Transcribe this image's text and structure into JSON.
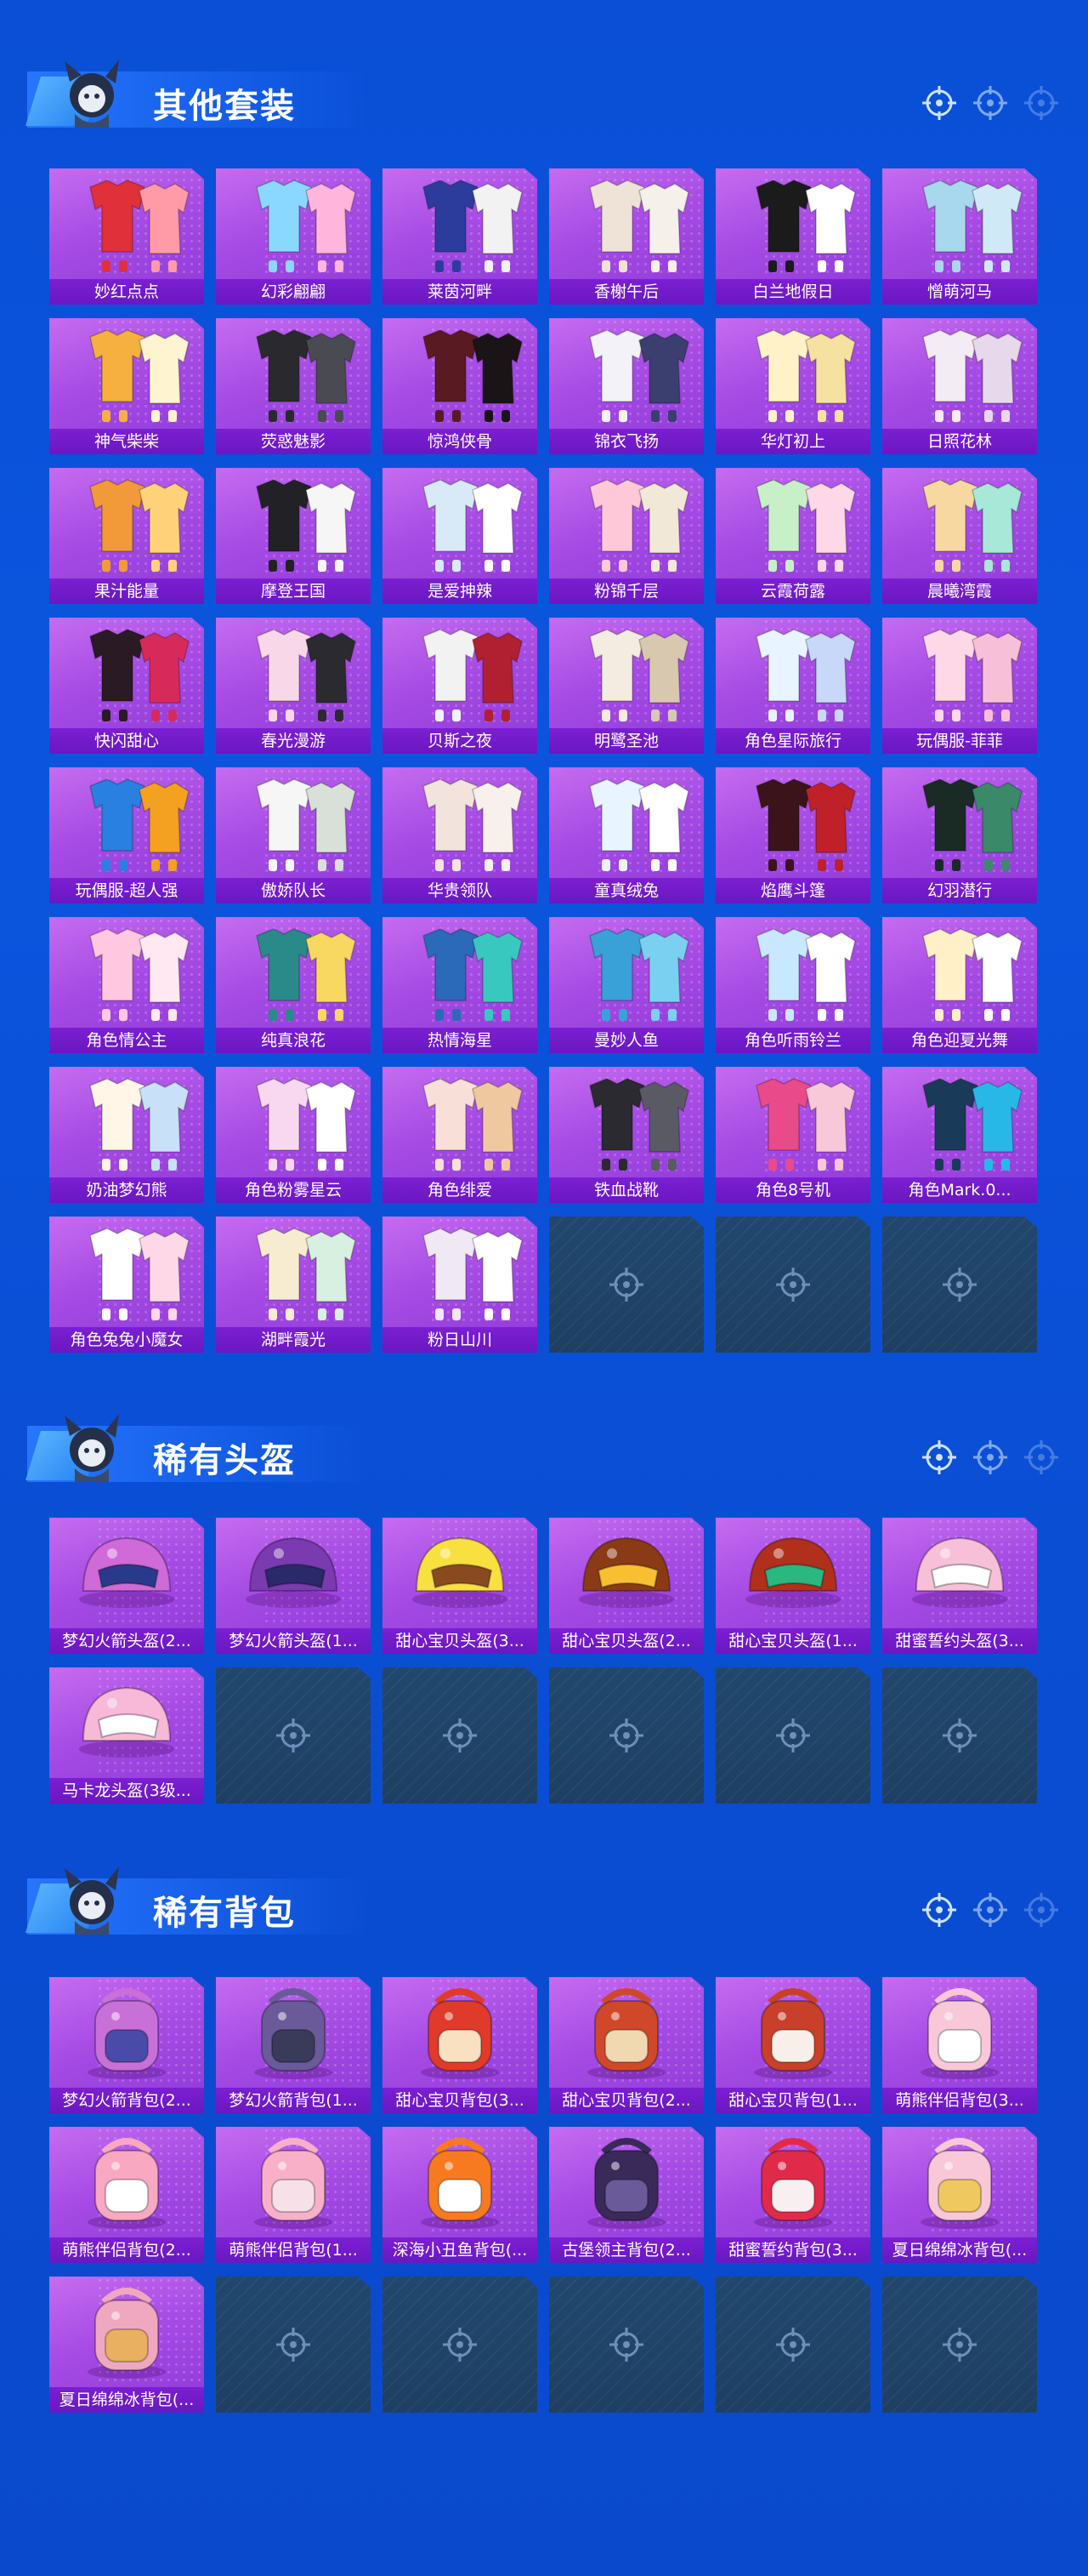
{
  "sections": {
    "outfits": {
      "title": "其他套装",
      "items": [
        {
          "label": "妙红点点",
          "c1": "#e0303a",
          "c2": "#ff9aa6"
        },
        {
          "label": "幻彩翩翩",
          "c1": "#8ad8ff",
          "c2": "#ffb5dc"
        },
        {
          "label": "莱茵河畔",
          "c1": "#2c3c9c",
          "c2": "#f2f2f2"
        },
        {
          "label": "香榭午后",
          "c1": "#efe2d6",
          "c2": "#f6f0ea"
        },
        {
          "label": "白兰地假日",
          "c1": "#1b1b1b",
          "c2": "#ffffff"
        },
        {
          "label": "憎萌河马",
          "c1": "#a8d8ee",
          "c2": "#cfeaf6"
        },
        {
          "label": "神气柴柴",
          "c1": "#f5b040",
          "c2": "#fff4d0"
        },
        {
          "label": "荧惑魅影",
          "c1": "#2a2a2e",
          "c2": "#4a4a52"
        },
        {
          "label": "惊鸿侠骨",
          "c1": "#5a1a22",
          "c2": "#1a1416"
        },
        {
          "label": "锦衣飞扬",
          "c1": "#f2f2f8",
          "c2": "#3a3f70"
        },
        {
          "label": "华灯初上",
          "c1": "#fff2c8",
          "c2": "#f6e2a0"
        },
        {
          "label": "日照花林",
          "c1": "#f4ecf4",
          "c2": "#e8d8ec"
        },
        {
          "label": "果汁能量",
          "c1": "#f29a3a",
          "c2": "#ffd27a"
        },
        {
          "label": "摩登王国",
          "c1": "#222226",
          "c2": "#f6f6f6"
        },
        {
          "label": "是爱抻辣",
          "c1": "#d8eaf8",
          "c2": "#ffffff"
        },
        {
          "label": "粉锦千层",
          "c1": "#ffc8d8",
          "c2": "#f2e8d8"
        },
        {
          "label": "云霞荷露",
          "c1": "#c8f0c8",
          "c2": "#ffd8e8"
        },
        {
          "label": "晨曦湾霞",
          "c1": "#f6d8a0",
          "c2": "#a8e8d8"
        },
        {
          "label": "快闪甜心",
          "c1": "#2a1a24",
          "c2": "#d82a5a"
        },
        {
          "label": "春光漫游",
          "c1": "#f8d8e8",
          "c2": "#2a2a30"
        },
        {
          "label": "贝斯之夜",
          "c1": "#f2f2f2",
          "c2": "#b02030"
        },
        {
          "label": "明鹭圣池",
          "c1": "#f4ece0",
          "c2": "#d8c8b0"
        },
        {
          "label": "角色星际旅行",
          "c1": "#e8f4ff",
          "c2": "#c8d8f8"
        },
        {
          "label": "玩偶服-菲菲",
          "c1": "#ffd8e8",
          "c2": "#f8c0d8"
        },
        {
          "label": "玩偶服-超人强",
          "c1": "#2a80e0",
          "c2": "#f4a020"
        },
        {
          "label": "傲娇队长",
          "c1": "#f6f6f6",
          "c2": "#d8e0d8"
        },
        {
          "label": "华贵领队",
          "c1": "#f2e4dc",
          "c2": "#f8f0ea"
        },
        {
          "label": "童真绒兔",
          "c1": "#e8f4ff",
          "c2": "#ffffff"
        },
        {
          "label": "焰鹰斗篷",
          "c1": "#3a1418",
          "c2": "#c02028"
        },
        {
          "label": "幻羽潜行",
          "c1": "#1a2a24",
          "c2": "#3a8a6a"
        },
        {
          "label": "角色情公主",
          "c1": "#ffc8e0",
          "c2": "#ffe8f2"
        },
        {
          "label": "纯真浪花",
          "c1": "#2a8a8a",
          "c2": "#f8d860"
        },
        {
          "label": "热情海星",
          "c1": "#2a6ab8",
          "c2": "#38c8c0"
        },
        {
          "label": "曼妙人鱼",
          "c1": "#3aa0d8",
          "c2": "#7ad0f0"
        },
        {
          "label": "角色听雨铃兰",
          "c1": "#c8e8ff",
          "c2": "#ffffff"
        },
        {
          "label": "角色迎夏光舞",
          "c1": "#fff0c8",
          "c2": "#ffffff"
        },
        {
          "label": "奶油梦幻熊",
          "c1": "#fff6e8",
          "c2": "#c8e0f8"
        },
        {
          "label": "角色粉雾星云",
          "c1": "#f8d8f0",
          "c2": "#ffffff"
        },
        {
          "label": "角色绯爱",
          "c1": "#f8e0d8",
          "c2": "#f0c8a0"
        },
        {
          "label": "铁血战靴",
          "c1": "#2a2a30",
          "c2": "#5a5a64"
        },
        {
          "label": "角色8号机",
          "c1": "#e84a8a",
          "c2": "#f8c8d8"
        },
        {
          "label": "角色Mark.0...",
          "c1": "#1a3a5a",
          "c2": "#28b8e8"
        },
        {
          "label": "角色兔兔小魔女",
          "c1": "#ffffff",
          "c2": "#ffd8e8"
        },
        {
          "label": "湖畔霞光",
          "c1": "#f8ecd0",
          "c2": "#d8f0e0"
        },
        {
          "label": "粉日山川",
          "c1": "#f0e8f4",
          "c2": "#ffffff"
        }
      ]
    },
    "helmets": {
      "title": "稀有头盔",
      "items": [
        {
          "label": "梦幻火箭头盔(2...",
          "c1": "#d06ad8",
          "c2": "#2a3a8a"
        },
        {
          "label": "梦幻火箭头盔(1...",
          "c1": "#7a3ab0",
          "c2": "#2a2a6a"
        },
        {
          "label": "甜心宝贝头盔(3...",
          "c1": "#f8e040",
          "c2": "#8a4a20"
        },
        {
          "label": "甜心宝贝头盔(2...",
          "c1": "#8a3a14",
          "c2": "#f8c030"
        },
        {
          "label": "甜心宝贝头盔(1...",
          "c1": "#b0301c",
          "c2": "#2ab880"
        },
        {
          "label": "甜蜜誓约头盔(3...",
          "c1": "#f8c0d8",
          "c2": "#ffffff"
        },
        {
          "label": "马卡龙头盔(3级...",
          "c1": "#f8b8d8",
          "c2": "#ffffff"
        }
      ]
    },
    "backpacks": {
      "title": "稀有背包",
      "items": [
        {
          "label": "梦幻火箭背包(2...",
          "c1": "#c870d8",
          "c2": "#4a4aa8"
        },
        {
          "label": "梦幻火箭背包(1...",
          "c1": "#6a5a9a",
          "c2": "#3a3a5a"
        },
        {
          "label": "甜心宝贝背包(3...",
          "c1": "#e03a2a",
          "c2": "#f8e0c0"
        },
        {
          "label": "甜心宝贝背包(2...",
          "c1": "#d0482a",
          "c2": "#f0d8b0"
        },
        {
          "label": "甜心宝贝背包(1...",
          "c1": "#c8402a",
          "c2": "#f8f0e8"
        },
        {
          "label": "萌熊伴侣背包(3...",
          "c1": "#f8c8d8",
          "c2": "#ffffff"
        },
        {
          "label": "萌熊伴侣背包(2...",
          "c1": "#f8a8c0",
          "c2": "#ffffff"
        },
        {
          "label": "萌熊伴侣背包(1...",
          "c1": "#f8b0c8",
          "c2": "#f8e0e8"
        },
        {
          "label": "深海小丑鱼背包(...",
          "c1": "#f87a20",
          "c2": "#ffffff"
        },
        {
          "label": "古堡领主背包(2...",
          "c1": "#3a2a5a",
          "c2": "#6a5a9a"
        },
        {
          "label": "甜蜜誓约背包(3...",
          "c1": "#e02a4a",
          "c2": "#f8f0f0"
        },
        {
          "label": "夏日绵绵冰背包(...",
          "c1": "#f8c8d8",
          "c2": "#f0c860"
        },
        {
          "label": "夏日绵绵冰背包(...",
          "c1": "#f0a8c0",
          "c2": "#e8b060"
        }
      ]
    }
  },
  "icons": {
    "header_target": "crosshair-icon",
    "empty_slot": "crosshair-icon",
    "mascot": "mascot-icon"
  }
}
